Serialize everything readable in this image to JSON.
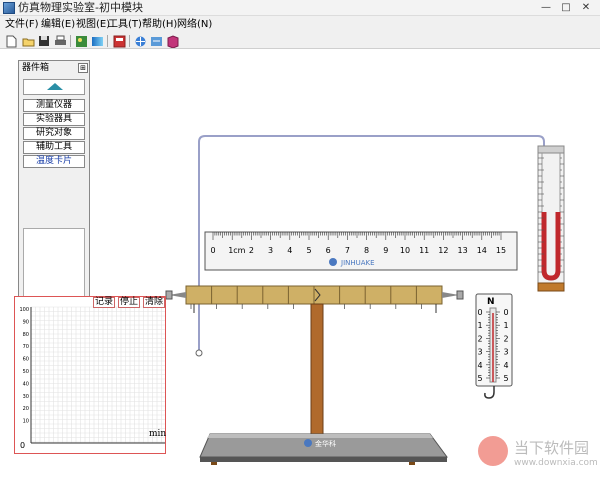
{
  "window": {
    "title": "仿真物理实验室-初中模块"
  },
  "menu": [
    {
      "label": "文件(F)"
    },
    {
      "label": "编辑(E)"
    },
    {
      "label": "视图(E)"
    },
    {
      "label": "工具(T)"
    },
    {
      "label": "帮助(H)"
    },
    {
      "label": "网络(N)"
    }
  ],
  "toolbar": {
    "icons": [
      "new-file-icon",
      "open-folder-icon",
      "save-icon",
      "print-icon",
      "image-icon",
      "gradient-icon",
      "calculator-icon",
      "network-icon",
      "network-sync-icon",
      "book-icon"
    ]
  },
  "toolbox": {
    "title": "器件箱",
    "categories": [
      {
        "label": "测量仪器"
      },
      {
        "label": "实验器具"
      },
      {
        "label": "研究对象"
      },
      {
        "label": "辅助工具"
      },
      {
        "label": "温度卡片"
      }
    ]
  },
  "graph": {
    "buttons": {
      "record": "记录",
      "stop": "停止",
      "clear": "清除"
    },
    "y_ticks": [
      "100",
      "90",
      "80",
      "70",
      "60",
      "50",
      "40",
      "30",
      "20",
      "10",
      "0"
    ],
    "origin": "0",
    "x_unit": "min"
  },
  "ruler": {
    "labels": [
      "0",
      "1cm",
      "2",
      "3",
      "4",
      "5",
      "6",
      "7",
      "8",
      "9",
      "10",
      "11",
      "12",
      "13",
      "14",
      "15"
    ],
    "brand": "JINHUAKE"
  },
  "spring_scale": {
    "unit": "N",
    "labels": [
      "0",
      "1",
      "2",
      "3",
      "4",
      "5"
    ]
  },
  "base": {
    "brand": "金华科"
  },
  "watermark": {
    "name": "当下软件园",
    "url": "www.downxia.com"
  },
  "colors": {
    "accent": "#2a8fa6",
    "rod": "#cfb066",
    "stand": "#b06a2c",
    "liquid": "#c0282c"
  }
}
